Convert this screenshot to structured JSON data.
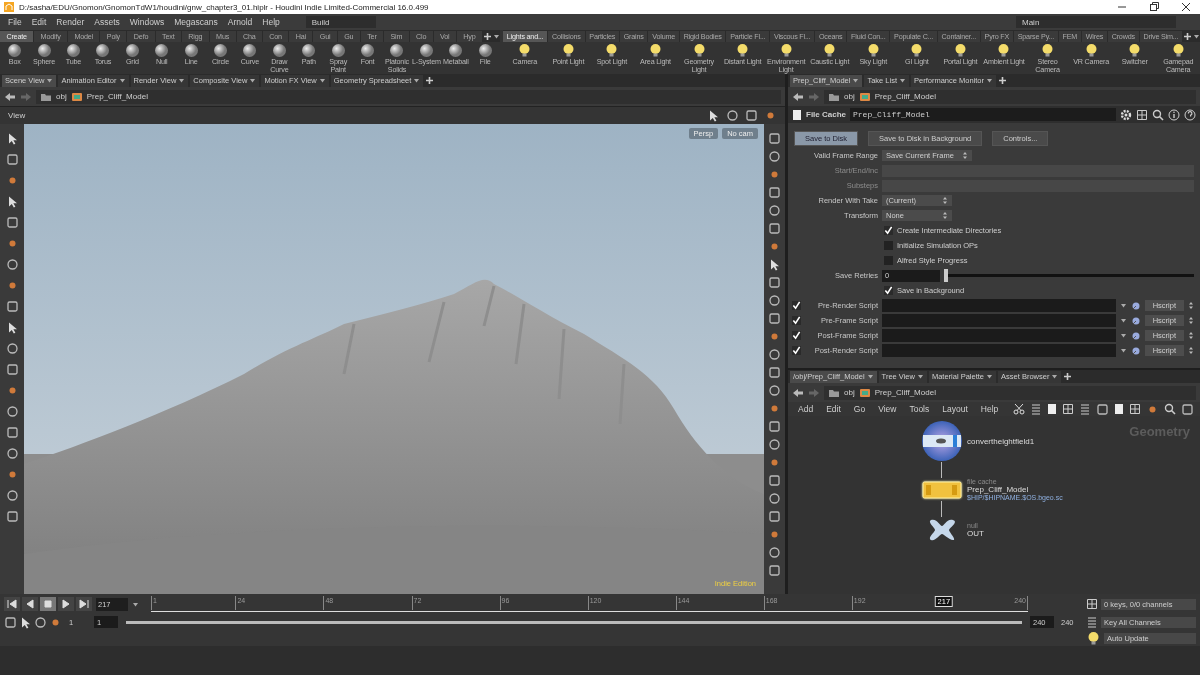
{
  "window": {
    "title": "D:/sasha/EDU/Gnomon/GnomonTdW1/houdini/gnw_chapter3_01.hiplr - Houdini Indie Limited-Commercial 16.0.499"
  },
  "menu_bar": {
    "items": [
      "File",
      "Edit",
      "Render",
      "Assets",
      "Windows",
      "Megascans",
      "Arnold",
      "Help"
    ],
    "shelf_desktop": "Build",
    "desktop": "Main"
  },
  "shelves": [
    {
      "tabs": [
        {
          "label": "Create",
          "selected": true
        },
        {
          "label": "Modify",
          "selected": false
        },
        {
          "label": "Model",
          "selected": false
        },
        {
          "label": "Poly",
          "selected": false
        },
        {
          "label": "Defo",
          "selected": false
        },
        {
          "label": "Text",
          "selected": false
        },
        {
          "label": "Rigg",
          "selected": false
        },
        {
          "label": "Mus",
          "selected": false
        },
        {
          "label": "Cha",
          "selected": false
        },
        {
          "label": "Con",
          "selected": false
        },
        {
          "label": "Hai",
          "selected": false
        },
        {
          "label": "Gui",
          "selected": false
        },
        {
          "label": "Gu",
          "selected": false
        },
        {
          "label": "Ter",
          "selected": false
        },
        {
          "label": "Sim",
          "selected": false
        },
        {
          "label": "Clo",
          "selected": false
        },
        {
          "label": "Vol",
          "selected": false
        },
        {
          "label": "Hyp",
          "selected": false
        }
      ],
      "tools": [
        "Box",
        "Sphere",
        "Tube",
        "Torus",
        "Grid",
        "Null",
        "Line",
        "Circle",
        "Curve",
        "Draw Curve",
        "Path",
        "Spray Paint",
        "Font",
        "Platonic Solids",
        "L-System",
        "Metaball",
        "File"
      ]
    },
    {
      "tabs": [
        {
          "label": "Lights and...",
          "selected": true
        },
        {
          "label": "Collisions",
          "selected": false
        },
        {
          "label": "Particles",
          "selected": false
        },
        {
          "label": "Grains",
          "selected": false
        },
        {
          "label": "Volume",
          "selected": false
        },
        {
          "label": "Rigid Bodies",
          "selected": false
        },
        {
          "label": "Particle Fl...",
          "selected": false
        },
        {
          "label": "Viscous Fl...",
          "selected": false
        },
        {
          "label": "Oceans",
          "selected": false
        },
        {
          "label": "Fluid Con...",
          "selected": false
        },
        {
          "label": "Populate C...",
          "selected": false
        },
        {
          "label": "Container...",
          "selected": false
        },
        {
          "label": "Pyro FX",
          "selected": false
        },
        {
          "label": "Sparse Py...",
          "selected": false
        },
        {
          "label": "FEM",
          "selected": false
        },
        {
          "label": "Wires",
          "selected": false
        },
        {
          "label": "Crowds",
          "selected": false
        },
        {
          "label": "Drive Sim...",
          "selected": false
        }
      ],
      "tools": [
        "Camera",
        "Point Light",
        "Spot Light",
        "Area Light",
        "Geometry Light",
        "Distant Light",
        "Environment Light",
        "Caustic Light",
        "Sky Light",
        "GI Light",
        "Portal Light",
        "Ambient Light",
        "Stereo Camera",
        "VR Camera",
        "Switcher",
        "Gamepad Camera"
      ]
    }
  ],
  "scene_pane": {
    "tabs": [
      {
        "label": "Scene View",
        "selected": true
      },
      {
        "label": "Animation Editor",
        "selected": false
      },
      {
        "label": "Render View",
        "selected": false
      },
      {
        "label": "Composite View",
        "selected": false
      },
      {
        "label": "Motion FX View",
        "selected": false
      },
      {
        "label": "Geometry Spreadsheet",
        "selected": false
      }
    ],
    "path": [
      "obj",
      "Prep_Cliff_Model"
    ],
    "title": "View",
    "camera_menus": [
      "Persp",
      "No cam"
    ],
    "badge": "Indie Edition"
  },
  "parameter_pane": {
    "tabs": [
      {
        "label": "Prep_Cliff_Model",
        "selected": true
      },
      {
        "label": "Take List",
        "selected": false
      },
      {
        "label": "Performance Monitor",
        "selected": false
      }
    ],
    "path": [
      "obj",
      "Prep_Cliff_Model"
    ],
    "node_type": "File Cache",
    "node_name": "Prep_Cliff_Model",
    "buttons": [
      {
        "label": "Save to Disk",
        "selected": true
      },
      {
        "label": "Save to Disk in Background",
        "selected": false
      },
      {
        "label": "Controls...",
        "selected": false
      }
    ],
    "rows": [
      {
        "kind": "menu",
        "label": "Valid Frame Range",
        "value": "Save Current Frame",
        "disabled": false
      },
      {
        "kind": "field",
        "label": "Start/End/Inc",
        "disabled": true
      },
      {
        "kind": "field",
        "label": "Substeps",
        "disabled": true
      },
      {
        "kind": "menu",
        "label": "Render With Take",
        "value": "(Current)",
        "disabled": false
      },
      {
        "kind": "menu",
        "label": "Transform",
        "value": "None",
        "disabled": false
      },
      {
        "kind": "checkbox",
        "label": "Create Intermediate Directories",
        "checked": true
      },
      {
        "kind": "checkbox",
        "label": "Initialize Simulation OPs",
        "checked": false
      },
      {
        "kind": "checkbox",
        "label": "Alfred Style Progress",
        "checked": false
      },
      {
        "kind": "slider",
        "label": "Save Retries",
        "value": "0",
        "level": 0
      },
      {
        "kind": "checkbox",
        "label": "Save in Background",
        "checked": true
      },
      {
        "kind": "script",
        "label": "Pre-Render Script",
        "checked": true,
        "language": "Hscript"
      },
      {
        "kind": "script",
        "label": "Pre-Frame Script",
        "checked": true,
        "language": "Hscript"
      },
      {
        "kind": "script",
        "label": "Post-Frame Script",
        "checked": true,
        "language": "Hscript"
      },
      {
        "kind": "script",
        "label": "Post-Render Script",
        "checked": true,
        "language": "Hscript"
      }
    ]
  },
  "network_pane": {
    "tabs": [
      {
        "label": "/obj/Prep_Cliff_Model",
        "selected": true
      },
      {
        "label": "Tree View",
        "selected": false
      },
      {
        "label": "Material Palette",
        "selected": false
      },
      {
        "label": "Asset Browser",
        "selected": false
      }
    ],
    "path": [
      "obj",
      "Prep_Cliff_Model"
    ],
    "menu": [
      "Add",
      "Edit",
      "Go",
      "View",
      "Tools",
      "Layout",
      "Help"
    ],
    "context": "Geometry",
    "nodes": [
      {
        "kind": "heightfield",
        "name": "convertheightfield1",
        "selected": false
      },
      {
        "kind": "filecache",
        "type_label": "file cache",
        "name": "Prep_Cliff_Model",
        "info": "$HIP/$HIPNAME.$OS.bgeo.sc",
        "selected": true
      },
      {
        "kind": "null",
        "type_label": "null",
        "name": "OUT",
        "selected": false
      }
    ]
  },
  "timeline": {
    "buttons": [
      {
        "kind": "first",
        "selected": false
      },
      {
        "kind": "back",
        "selected": false
      },
      {
        "kind": "stop",
        "selected": true
      },
      {
        "kind": "play",
        "selected": false
      },
      {
        "kind": "last",
        "selected": false
      }
    ],
    "frame": "217",
    "ticks": [
      "1",
      "24",
      "48",
      "72",
      "96",
      "120",
      "144",
      "168",
      "192",
      "240"
    ],
    "current": "217",
    "playhead": {
      "level": 0.904
    },
    "range": {
      "start": "1",
      "start_play": "1",
      "end_play": "240",
      "end": "240",
      "level": 1
    },
    "keys": "0 keys, 0/0 channels",
    "key_all": "Key All Channels",
    "update": "Auto Update"
  }
}
